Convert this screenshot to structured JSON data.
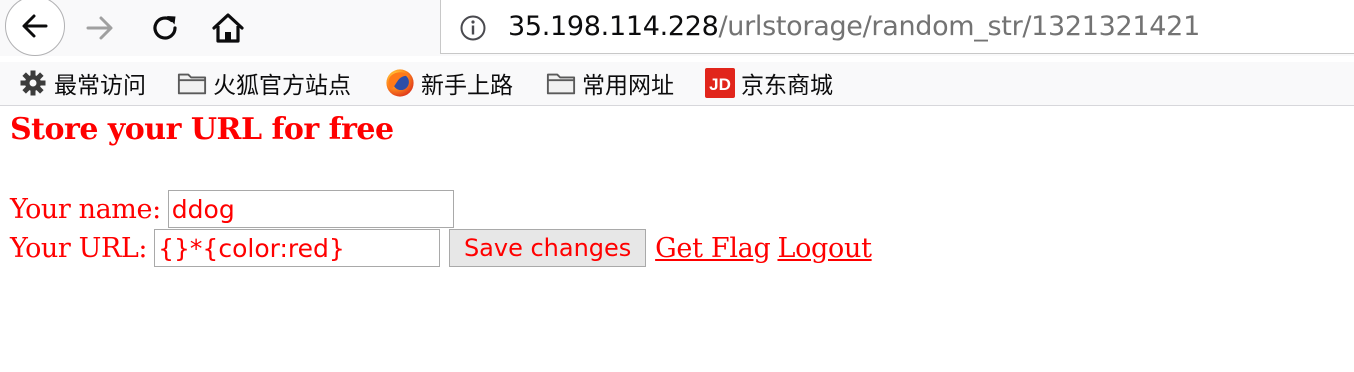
{
  "browser": {
    "nav": {
      "back_icon": "back-arrow-icon",
      "forward_icon": "forward-arrow-icon",
      "reload_icon": "reload-icon",
      "home_icon": "home-icon"
    },
    "url": {
      "host": "35.198.114.228",
      "path": "/urlstorage/random_str/1321321421",
      "info_icon": "info-icon"
    },
    "bookmarks": [
      {
        "label": "最常访问",
        "icon": "gear-icon"
      },
      {
        "label": "火狐官方站点",
        "icon": "folder-icon"
      },
      {
        "label": "新手上路",
        "icon": "firefox-icon"
      },
      {
        "label": "常用网址",
        "icon": "folder-icon"
      },
      {
        "label": "京东商城",
        "icon": "jd-icon",
        "icon_text": "JD"
      }
    ]
  },
  "page": {
    "title": "Store your URL for free",
    "form": {
      "name_label": "Your name:",
      "name_value": "ddog",
      "url_label": "Your URL:",
      "url_value": "{}*{color:red}",
      "save_label": "Save changes"
    },
    "links": {
      "get_flag": "Get Flag",
      "logout": "Logout"
    }
  },
  "colors": {
    "page_text": "#ff0000",
    "url_host": "#0c0c0d",
    "url_path": "#737373",
    "jd_brand": "#e1251b"
  }
}
